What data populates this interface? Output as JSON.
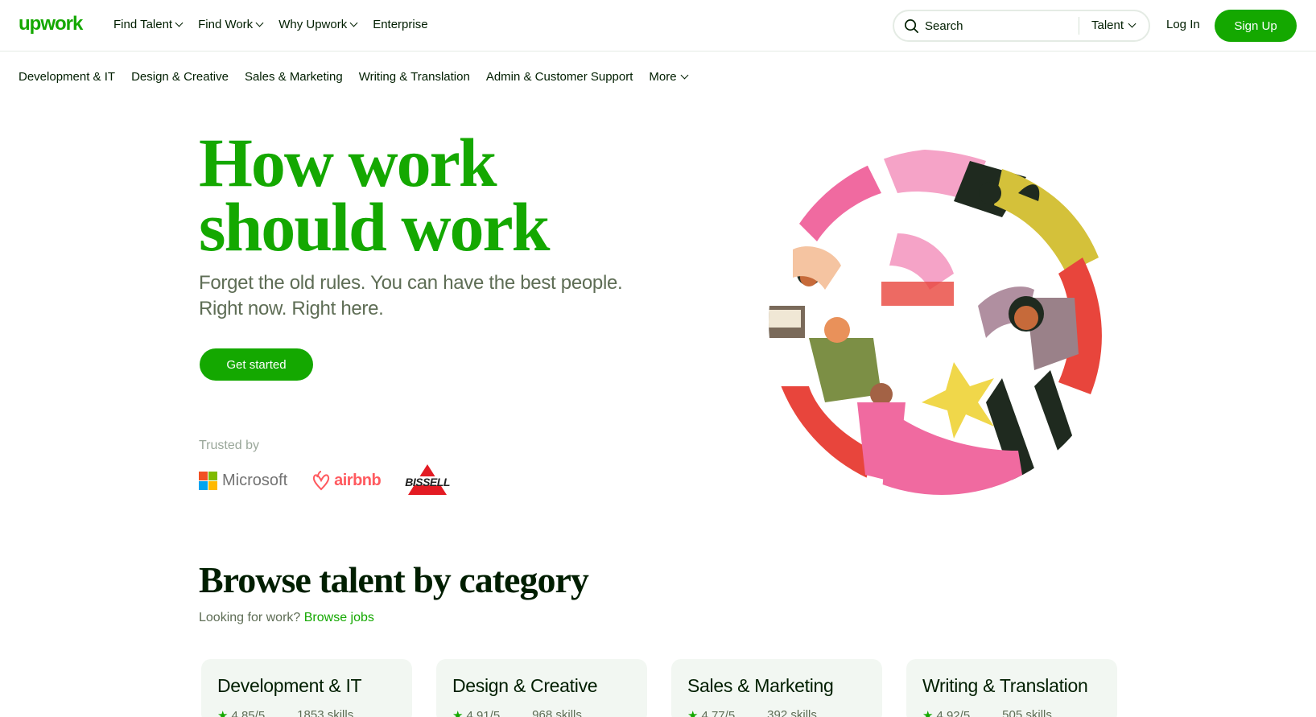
{
  "brand": {
    "logo_text": "upwork",
    "accent": "#14a800"
  },
  "nav": {
    "items": [
      {
        "label": "Find Talent",
        "has_dropdown": true
      },
      {
        "label": "Find Work",
        "has_dropdown": true
      },
      {
        "label": "Why Upwork",
        "has_dropdown": true
      },
      {
        "label": "Enterprise",
        "has_dropdown": false
      }
    ],
    "search_placeholder": "Search",
    "search_scope": "Talent",
    "login_label": "Log In",
    "signup_label": "Sign Up"
  },
  "categories_nav": [
    "Development & IT",
    "Design & Creative",
    "Sales & Marketing",
    "Writing & Translation",
    "Admin & Customer Support",
    "More"
  ],
  "hero": {
    "title_line1": "How work",
    "title_line2": "should work",
    "subtitle_line1": "Forget the old rules. You can have the best people.",
    "subtitle_line2": "Right now. Right here.",
    "cta_label": "Get started",
    "trusted_by": "Trusted by",
    "trusted_logos": [
      "Microsoft",
      "airbnb",
      "BISSELL"
    ]
  },
  "browse": {
    "title": "Browse talent by category",
    "prompt": "Looking for work?",
    "link_label": "Browse jobs",
    "cards": [
      {
        "title": "Development & IT",
        "rating": "4.85/5",
        "skills": "1853 skills"
      },
      {
        "title": "Design & Creative",
        "rating": "4.91/5",
        "skills": "968 skills"
      },
      {
        "title": "Sales & Marketing",
        "rating": "4.77/5",
        "skills": "392 skills"
      },
      {
        "title": "Writing & Translation",
        "rating": "4.92/5",
        "skills": "505 skills"
      }
    ]
  }
}
